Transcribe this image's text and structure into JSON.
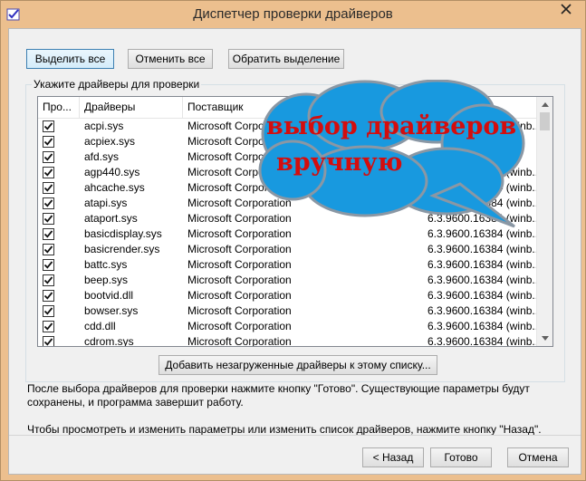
{
  "window": {
    "title": "Диспетчер проверки драйверов"
  },
  "toolbar": {
    "select_all": "Выделить все",
    "deselect_all": "Отменить все",
    "invert_selection": "Обратить выделение"
  },
  "group": {
    "label": "Укажите драйверы для проверки"
  },
  "columns": {
    "check": "Про...",
    "driver": "Драйверы",
    "provider": "Поставщик",
    "version": ""
  },
  "drivers": [
    {
      "name": "acpi.sys",
      "provider": "Microsoft Corporation",
      "version": "6.3.9600.16384 (winb...",
      "checked": true
    },
    {
      "name": "acpiex.sys",
      "provider": "Microsoft Corporation",
      "version": "",
      "checked": true
    },
    {
      "name": "afd.sys",
      "provider": "Microsoft Corporation",
      "version": "",
      "checked": true
    },
    {
      "name": "agp440.sys",
      "provider": "Microsoft Corporation",
      "version": "6.3.9600.16384 (winb...",
      "checked": true
    },
    {
      "name": "ahcache.sys",
      "provider": "Microsoft Corporation",
      "version": "6.3.9600.16384 (winb...",
      "checked": true
    },
    {
      "name": "atapi.sys",
      "provider": "Microsoft Corporation",
      "version": "6.3.9600.16384 (winb...",
      "checked": true
    },
    {
      "name": "ataport.sys",
      "provider": "Microsoft Corporation",
      "version": "6.3.9600.16384 (winb...",
      "checked": true
    },
    {
      "name": "basicdisplay.sys",
      "provider": "Microsoft Corporation",
      "version": "6.3.9600.16384 (winb...",
      "checked": true
    },
    {
      "name": "basicrender.sys",
      "provider": "Microsoft Corporation",
      "version": "6.3.9600.16384 (winb...",
      "checked": true
    },
    {
      "name": "battc.sys",
      "provider": "Microsoft Corporation",
      "version": "6.3.9600.16384 (winb...",
      "checked": true
    },
    {
      "name": "beep.sys",
      "provider": "Microsoft Corporation",
      "version": "6.3.9600.16384 (winb...",
      "checked": true
    },
    {
      "name": "bootvid.dll",
      "provider": "Microsoft Corporation",
      "version": "6.3.9600.16384 (winb...",
      "checked": true
    },
    {
      "name": "bowser.sys",
      "provider": "Microsoft Corporation",
      "version": "6.3.9600.16384 (winb...",
      "checked": true
    },
    {
      "name": "cdd.dll",
      "provider": "Microsoft Corporation",
      "version": "6.3.9600.16384 (winb...",
      "checked": true
    },
    {
      "name": "cdrom.sys",
      "provider": "Microsoft Corporation",
      "version": "6.3.9600.16384 (winb...",
      "checked": true
    }
  ],
  "add_unloaded_button": "Добавить незагруженные драйверы к этому списку...",
  "note": {
    "line1": "После выбора драйверов для проверки нажмите кнопку \"Готово\". Существующие параметры будут сохранены, и программа завершит работу.",
    "line2": "Чтобы просмотреть и изменить параметры или изменить список драйверов, нажмите кнопку \"Назад\"."
  },
  "footer": {
    "back": "< Назад",
    "finish": "Готово",
    "cancel": "Отмена"
  },
  "annotation": {
    "line1": "выбор драйверов",
    "line2": "вручную"
  },
  "colors": {
    "frame": "#ecbf8e",
    "cloud_fill": "#1899df",
    "cloud_outline": "#8a97a4",
    "annotation_text": "#d40d0d"
  }
}
